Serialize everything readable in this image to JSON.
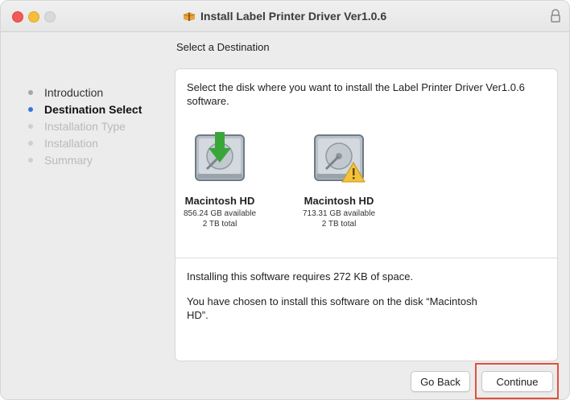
{
  "window": {
    "title": "Install Label Printer Driver Ver1.0.6"
  },
  "section_title": "Select a Destination",
  "sidebar": {
    "steps": [
      {
        "label": "Introduction",
        "state": "done"
      },
      {
        "label": "Destination Select",
        "state": "current"
      },
      {
        "label": "Installation Type",
        "state": "future"
      },
      {
        "label": "Installation",
        "state": "future"
      },
      {
        "label": "Summary",
        "state": "future"
      }
    ]
  },
  "panel": {
    "instruction": "Select the disk where you want to install the Label Printer Driver Ver1.0.6 software.",
    "disks": [
      {
        "name": "Macintosh HD",
        "available": "856.24 GB available",
        "total": "2 TB total",
        "badge": "install-arrow"
      },
      {
        "name": "Macintosh HD",
        "available": "713.31 GB available",
        "total": "2 TB total",
        "badge": "warning"
      }
    ],
    "requirement": "Installing this software requires 272 KB of space.",
    "chosen": "You have chosen to install this software on the disk “Macintosh HD”."
  },
  "buttons": {
    "back": "Go Back",
    "continue": "Continue"
  },
  "colors": {
    "accent": "#3477d6",
    "highlight": "#e2503a"
  }
}
